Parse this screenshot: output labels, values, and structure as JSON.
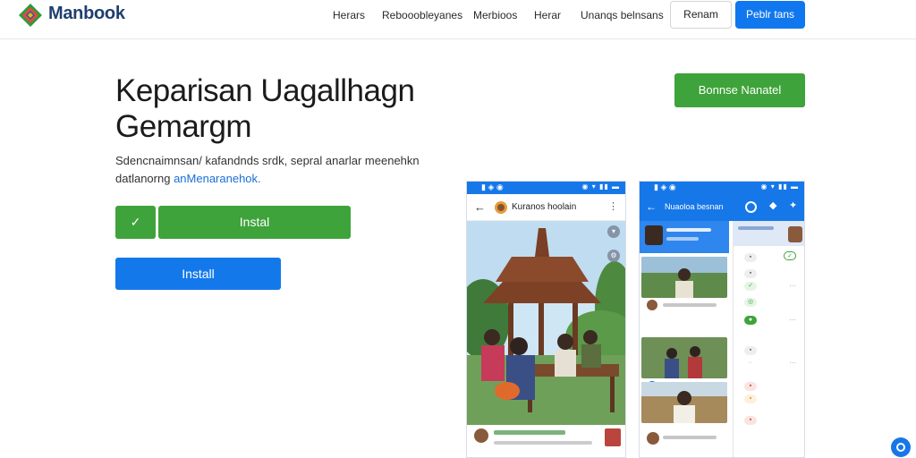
{
  "header": {
    "brand": "Manbook",
    "nav": [
      "Herars",
      "Rebooobleyanes",
      "Merbioos",
      "Herar",
      "Unanqs belnsans"
    ],
    "outline_button": "Renam",
    "blue_button": "Peblr tans"
  },
  "hero": {
    "title": "Keparisan Uagallhagn Gemargm",
    "description": "Sdencnaimnsan/ kafandnds srdk, sepral anarlar meenehkn datlanorng",
    "description_link": "anMenaranehok.",
    "check_glyph": "✓",
    "instal_button": "Instal",
    "install_button": "Install",
    "cta_button": "Bonnse Nanatel"
  },
  "phone_left": {
    "app_title": "Kuranos hoolain",
    "back_icon": "←",
    "more_icon": "⋮"
  },
  "phone_right": {
    "app_title": "Nuaoloa besnan",
    "back_icon": "←"
  },
  "colors": {
    "accent_blue": "#1677e8",
    "accent_green": "#3ea33a",
    "brand_navy": "#1f3f6e"
  }
}
